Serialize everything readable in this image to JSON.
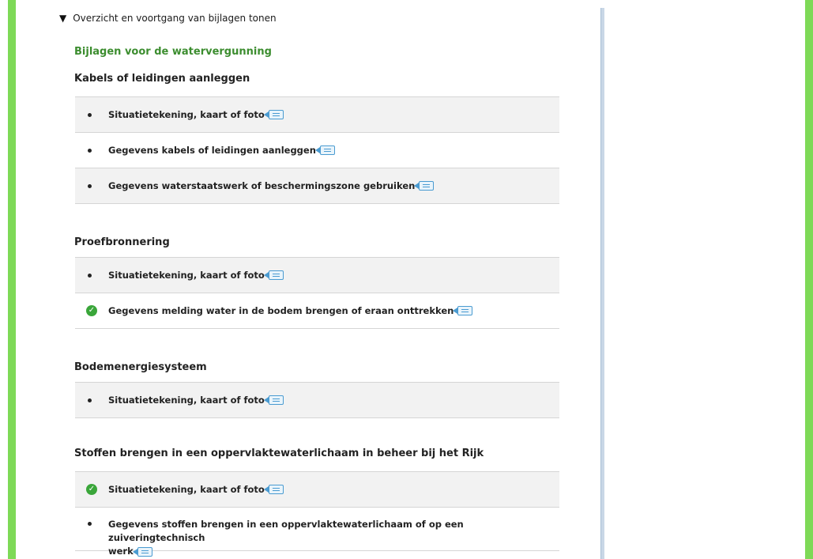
{
  "toggle": {
    "label": "Overzicht en voortgang van bijlagen tonen"
  },
  "section_title": "Bijlagen voor de watervergunning",
  "colors": {
    "accent_green": "#7ed957",
    "title_green": "#3c8d2f",
    "check_green": "#3aa63a",
    "info_blue": "#4a9bd1"
  },
  "groups": [
    {
      "title": "Kabels of leidingen aanleggen",
      "items": [
        {
          "label": "Situatietekening, kaart of foto",
          "status": "bullet"
        },
        {
          "label": "Gegevens kabels of leidingen aanleggen",
          "status": "bullet"
        },
        {
          "label": "Gegevens waterstaatswerk of beschermingszone gebruiken",
          "status": "bullet"
        }
      ]
    },
    {
      "title": "Proefbronnering",
      "items": [
        {
          "label": "Situatietekening, kaart of foto",
          "status": "bullet"
        },
        {
          "label": "Gegevens melding water in de bodem brengen of eraan onttrekken",
          "status": "check"
        }
      ]
    },
    {
      "title": "Bodemenergiesysteem",
      "items": [
        {
          "label": "Situatietekening, kaart of foto",
          "status": "bullet"
        }
      ]
    },
    {
      "title": "Stoffen brengen in een oppervlaktewaterlichaam in beheer bij het Rijk",
      "items": [
        {
          "label": "Situatietekening, kaart of foto",
          "status": "check"
        },
        {
          "label": "Gegevens stoffen brengen in een oppervlaktewaterlichaam of op een zuiveringtechnisch",
          "label_line2": "werk",
          "status": "bullet"
        }
      ]
    }
  ]
}
